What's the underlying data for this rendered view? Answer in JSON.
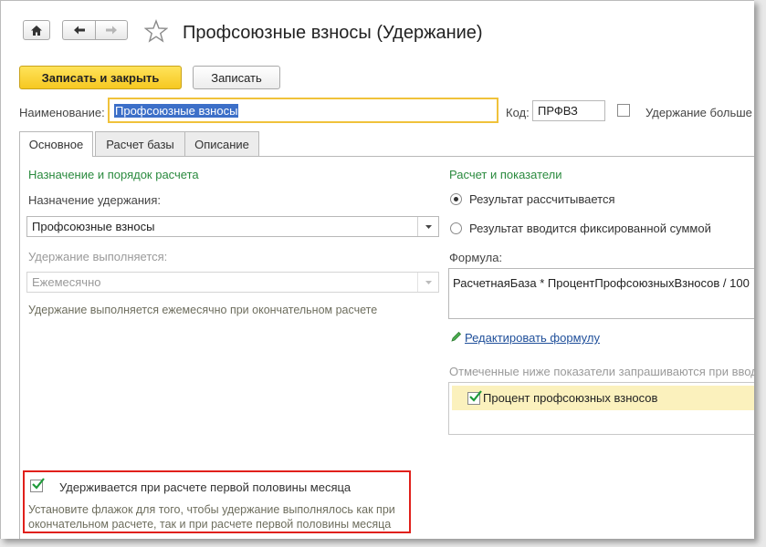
{
  "window": {
    "title": "Профсоюзные взносы (Удержание)",
    "icons": {
      "home": "home-icon",
      "back": "arrow-left-icon",
      "forward": "arrow-right-icon",
      "favorite": "star-icon"
    }
  },
  "toolbar": {
    "save_close_label": "Записать и закрыть",
    "save_label": "Записать"
  },
  "header": {
    "name_label": "Наименование:",
    "name_value": "Профсоюзные взносы",
    "code_label": "Код:",
    "code_value": "ПРФВЗ",
    "extra_checkbox_label": "Удержание больше"
  },
  "tabs": [
    {
      "label": "Основное",
      "active": true
    },
    {
      "label": "Расчет базы",
      "active": false
    },
    {
      "label": "Описание",
      "active": false
    }
  ],
  "left": {
    "section_title": "Назначение и порядок расчета",
    "purpose_label": "Назначение удержания:",
    "purpose_value": "Профсоюзные взносы",
    "executed_label": "Удержание выполняется:",
    "executed_value": "Ежемесячно",
    "executed_hint": "Удержание выполняется ежемесячно при окончательном расчете",
    "first_half_checkbox_label": "Удерживается при расчете первой половины месяца",
    "first_half_checked": true,
    "first_half_hint_line1": "Установите флажок для того, чтобы удержание выполнялось как при",
    "first_half_hint_line2": "окончательном расчете, так и при расчете первой половины месяца"
  },
  "right": {
    "section_title": "Расчет и показатели",
    "radio_calculated_label": "Результат рассчитывается",
    "radio_fixed_label": "Результат вводится фиксированной суммой",
    "selected_radio": "calculated",
    "formula_label": "Формула:",
    "formula_value": "РасчетнаяБаза * ПроцентПрофсоюзныхВзносов / 100",
    "edit_formula_link": "Редактировать формулу",
    "indicators_note": "Отмеченные ниже показатели запрашиваются при вводо",
    "indicators": [
      {
        "label": "Процент профсоюзных взносов",
        "checked": true
      }
    ]
  },
  "colors": {
    "accent_yellow": "#f6c821",
    "section_green": "#2a8a3e",
    "highlight_red": "#e0201b",
    "link_blue": "#1f4f9a"
  }
}
